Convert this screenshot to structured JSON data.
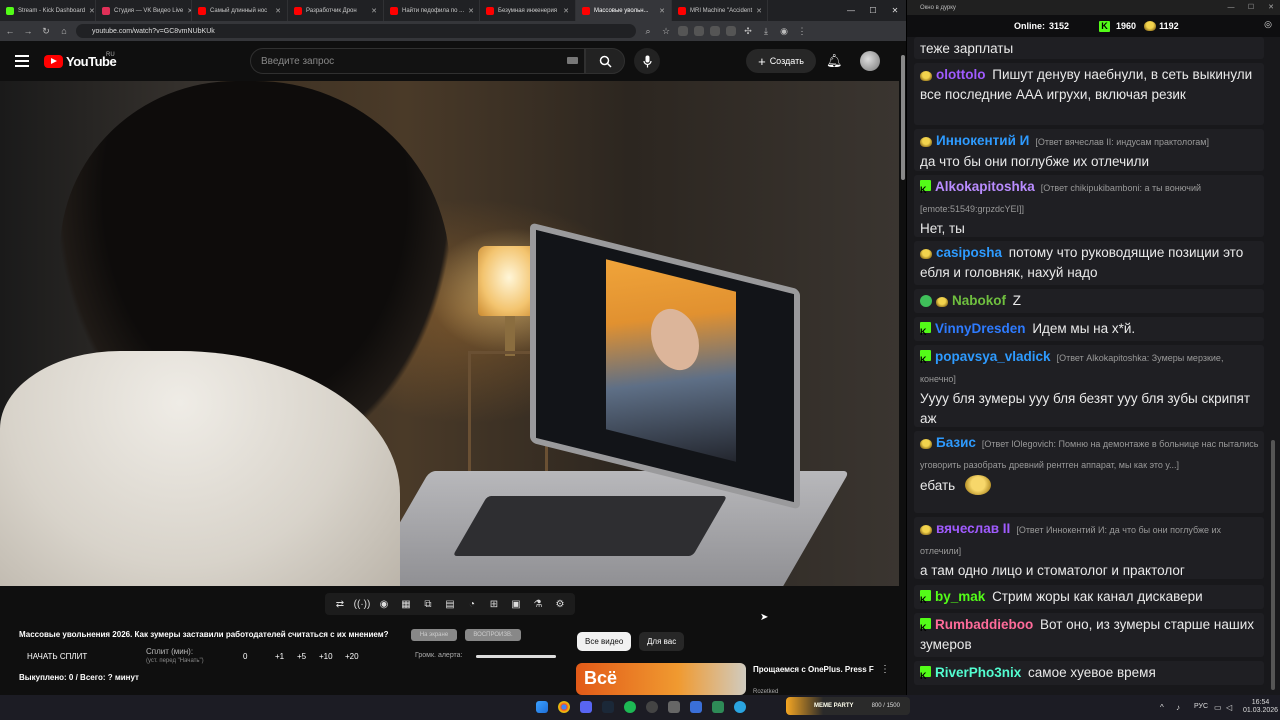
{
  "browser": {
    "tabs": [
      {
        "label": "Stream - Kick Dashboard",
        "color": "#53fc18",
        "active": false
      },
      {
        "label": "Студия — VK Видео Live",
        "color": "#e03058",
        "active": false
      },
      {
        "label": "Самый длинный нос",
        "color": "#ff0000",
        "active": false
      },
      {
        "label": "Разработчик Дрон",
        "color": "#ff0000",
        "active": false
      },
      {
        "label": "Найти педофила по ...",
        "color": "#ff0000",
        "active": false
      },
      {
        "label": "Безумная инженерия",
        "color": "#ff0000",
        "active": false
      },
      {
        "label": "Массовые увольн...",
        "color": "#ff0000",
        "active": true
      },
      {
        "label": "MRI Machine \"Accident",
        "color": "#ff0000",
        "active": false
      }
    ],
    "url": "youtube.com/watch?v=GC8vmNUbKUk"
  },
  "youtube": {
    "logo_text": "YouTube",
    "region": "RU",
    "search_placeholder": "Введите запрос",
    "create_label": "Создать"
  },
  "controls": {
    "video_title": "Массовые увольнения 2026. Как зумеры заставили работодателей считаться с их мнением?",
    "btn_disabled_1": "На экране",
    "btn_disabled_2": "ВОСПРОИЗВ.",
    "split_button": "НАЧАТЬ СПЛИТ",
    "split_label": "Сплит (мин):",
    "split_sub": "(уст. перед \"Начать\")",
    "split_values": [
      "0",
      "+1",
      "+5",
      "+10",
      "+20"
    ],
    "alert_label": "Громк. алерта:",
    "alert_level": 1.0,
    "bought": "Выкуплено: 0 / Всего: ? минут"
  },
  "recommendations": {
    "chips": [
      "Все видео",
      "Для вас"
    ],
    "item": {
      "thumb_text": "Всё",
      "title": "Прощаемся с OnePlus. Press F",
      "channel": "Rozetked"
    }
  },
  "chat": {
    "window_title": "Окно в дурку",
    "online_label": "Online:",
    "online_count": "3152",
    "kick_count": "1960",
    "other_count": "1192",
    "messages": [
      {
        "user": "",
        "color": "#eaeaea",
        "badge": "none",
        "reply": "",
        "text": "теже зарплаты"
      },
      {
        "user": "olottolo",
        "color": "#a05bff",
        "badge": "yellow",
        "reply": "",
        "text": "Пишут денуву наебнули, в сеть выкинули все последние ААА игрухи, включая резик"
      },
      {
        "user": "Иннокентий И",
        "color": "#2e9bff",
        "badge": "yellow",
        "reply": "[Ответ вячеслав II: индусам практологам]",
        "text": "да что бы они поглубже их отлечили"
      },
      {
        "user": "Alkokapitoshka",
        "color": "#b98cff",
        "badge": "kick",
        "reply": "[Ответ chikipukibamboni: а ты вонючий [emote:51549:grpzdcYEI]]",
        "text": "Нет, ты"
      },
      {
        "user": "casiposha",
        "color": "#2e9bff",
        "badge": "yellow",
        "reply": "",
        "text": "потому что руководящие позиции это ебля и головняк, нахуй надо"
      },
      {
        "user": "Nabokof",
        "color": "#6fbf3f",
        "badge": "yellow",
        "reply": "",
        "text": "Z"
      },
      {
        "user": "VinnyDresden",
        "color": "#2e7bff",
        "badge": "kick",
        "reply": "",
        "text": "Идем мы на х*й."
      },
      {
        "user": "popavsya_vladick",
        "color": "#2e9bff",
        "badge": "kick",
        "reply": "[Ответ Alkokapitoshka: Зумеры мерзкие, конечно]",
        "text": "Уууу бля зумеры ууу бля безят ууу бля зубы скрипят аж"
      },
      {
        "user": "Базис",
        "color": "#2e9bff",
        "badge": "yellow",
        "reply": "[Ответ lOlegovich: Помню на демонтаже в больнице нас пытались уговорить разобрать древний рентген аппарат, мы как это у...]",
        "text": "ебать"
      },
      {
        "user": "вячеслав II",
        "color": "#a05bff",
        "badge": "yellow",
        "reply": "[Ответ Иннокентий И: да что бы они поглубже их отлечили]",
        "text": "а там одно лицо и стоматолог и практолог"
      },
      {
        "user": "by_mak",
        "color": "#53fc18",
        "badge": "kick",
        "reply": "",
        "text": "Стрим жоры как канал дискавери"
      },
      {
        "user": "Rumbaddieboo",
        "color": "#ff6b9a",
        "badge": "kick",
        "reply": "",
        "text": "Вот оно, из зумеры старше наших зумеров"
      },
      {
        "user": "RiverPho3nix",
        "color": "#53fcd0",
        "badge": "kick",
        "reply": "",
        "text": "самое хуевое время"
      }
    ]
  },
  "taskbar": {
    "widget_label": "MEME PARTY",
    "widget_value": "800 / 1500",
    "lang": "РУС",
    "time": "16:54",
    "date": "01.03.2026"
  }
}
